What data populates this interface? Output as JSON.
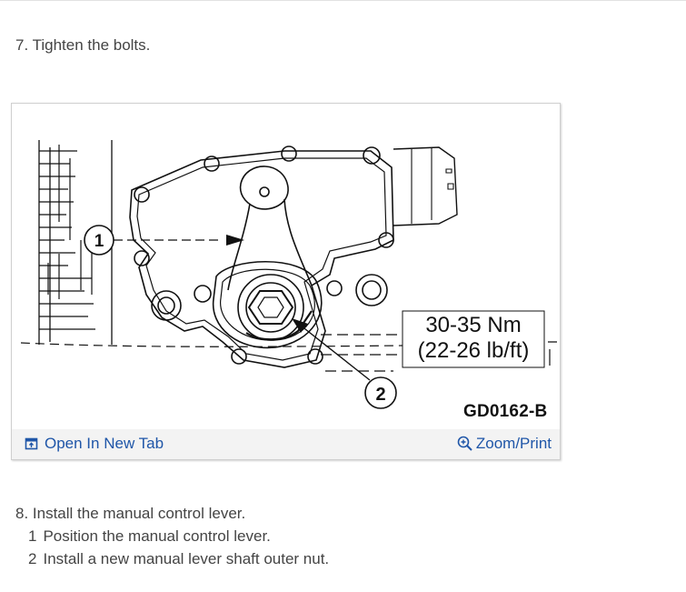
{
  "steps": {
    "step7": "7. Tighten the bolts.",
    "step8": "8. Install the manual control lever.",
    "substeps": [
      {
        "num": "1",
        "text": "Position the manual control lever."
      },
      {
        "num": "2",
        "text": "Install a new manual lever shaft outer nut."
      }
    ]
  },
  "figure": {
    "callout_1": "1",
    "callout_2": "2",
    "torque_metric": "30-35 Nm",
    "torque_imperial": "(22-26 lb/ft)",
    "code": "GD0162-B"
  },
  "toolbar": {
    "open_tab_label": "Open In New Tab",
    "open_tab_icon": "open-in-new-tab-icon",
    "zoom_label": "Zoom/Print",
    "zoom_icon": "zoom-in-icon",
    "link_color": "#1f56a8"
  }
}
